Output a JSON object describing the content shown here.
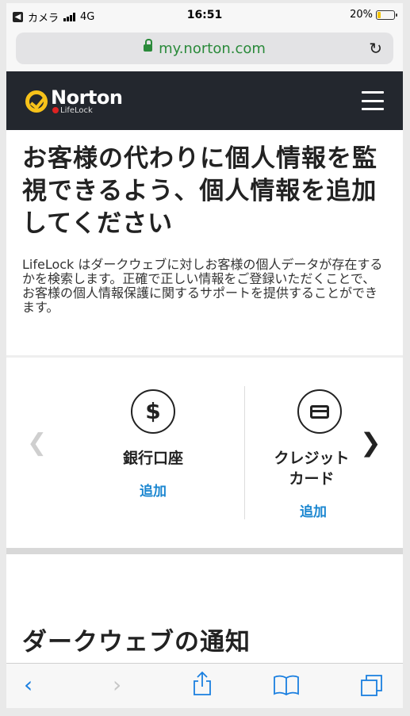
{
  "status_bar": {
    "carrier": "カメラ",
    "network": "4G",
    "time": "16:51",
    "battery": "20%",
    "battery_level": 0.2
  },
  "browser": {
    "url": "my.norton.com"
  },
  "header": {
    "brand": "Norton",
    "sub_brand": "LifeLock"
  },
  "main": {
    "headline": "お客様の代わりに個人情報を監視できるよう、個人情報を追加してください",
    "description": "LifeLock はダークウェブに対しお客様の個人データが存在するかを検索します。正確で正しい情報をご登録いただくことで、お客様の個人情報保護に関するサポートを提供することができます。",
    "cards": [
      {
        "title": "銀行口座",
        "link": "追加",
        "icon": "dollar-icon",
        "symbol": "$"
      },
      {
        "title": "クレジットカード",
        "link": "追加",
        "icon": "credit-card-icon"
      }
    ],
    "section_title": "ダークウェブの通知"
  },
  "toolbar": {
    "back_icon": "chevron-left-icon",
    "forward_icon": "chevron-right-icon",
    "share_icon": "share-icon",
    "bookmarks_icon": "book-icon",
    "tabs_icon": "tabs-icon"
  },
  "colors": {
    "nav_bg": "#23272e",
    "accent_yellow": "#f7c21a",
    "link_blue": "#1a86d0",
    "url_green": "#2a8a3a"
  }
}
